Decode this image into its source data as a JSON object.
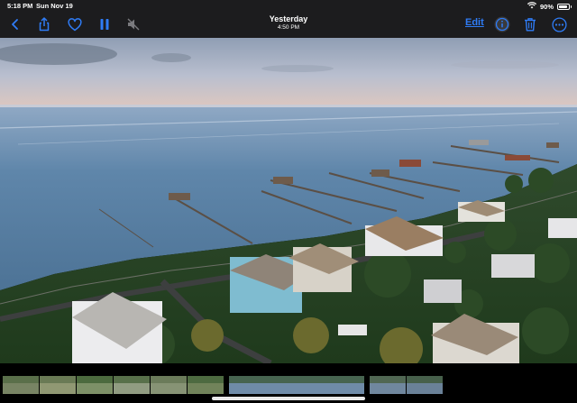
{
  "status_bar": {
    "time": "5:18 PM",
    "date": "Sun Nov 19",
    "wifi_icon": "wifi-icon",
    "battery_percent": "90%",
    "battery_level": 0.9
  },
  "toolbar": {
    "back_icon": "chevron-left-icon",
    "share_icon": "share-icon",
    "favorite_icon": "heart-icon",
    "pause_icon": "pause-icon",
    "mute_icon": "speaker-muted-icon",
    "title": "Yesterday",
    "subtitle": "4:50 PM",
    "edit_label": "Edit",
    "info_icon": "info-icon",
    "delete_icon": "trash-icon",
    "more_icon": "ellipsis-icon"
  },
  "colors": {
    "accent": "#2f7cf6",
    "toolbar_bg": "#1c1c1e"
  },
  "filmstrip": {
    "thumbnail_count": 9,
    "selected_index": 6
  }
}
